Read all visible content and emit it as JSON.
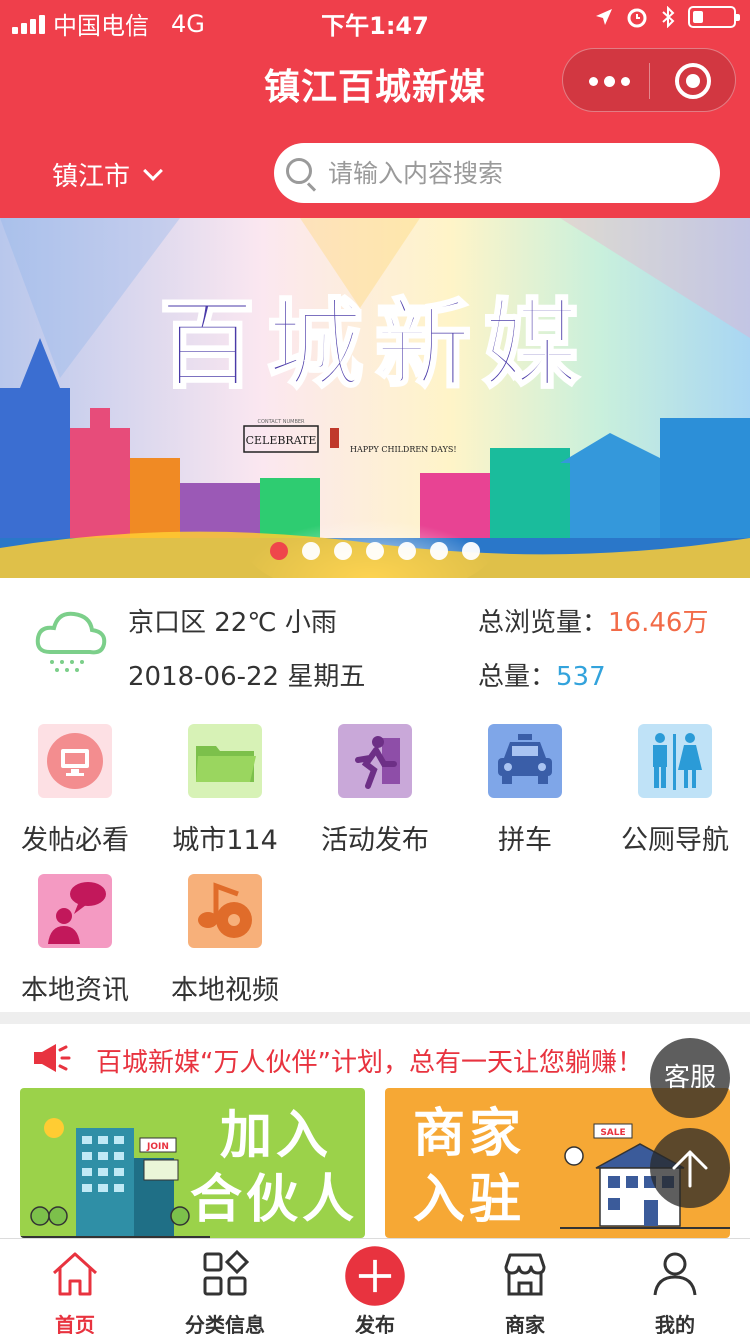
{
  "status_bar": {
    "carrier": "中国电信",
    "network": "4G",
    "time": "下午1:47"
  },
  "nav": {
    "title": "镇江百城新媒"
  },
  "header": {
    "city": "镇江市",
    "search_placeholder": "请输入内容搜索"
  },
  "banner": {
    "title_art": "百城新媒",
    "tag": "CELEBRATE",
    "tag_small": "CONTACT NUMBER",
    "subtitle": "HAPPY CHILDREN DAYS!",
    "slide_count": 7,
    "active_slide": 1
  },
  "info": {
    "weather": "京口区 22℃ 小雨",
    "date": "2018-06-22 星期五",
    "views_label": "总浏览量：",
    "views_value": "16.46万",
    "total_label": "总量：",
    "total_value": "537"
  },
  "categories": [
    {
      "label": "发帖必看",
      "icon": "monitor-icon",
      "color": "#fde0e4"
    },
    {
      "label": "城市114",
      "icon": "folder-icon",
      "color": "#d7f2b6"
    },
    {
      "label": "活动发布",
      "icon": "runner-icon",
      "color": "#c9a8d9"
    },
    {
      "label": "拼车",
      "icon": "car-icon",
      "color": "#7fa6e8"
    },
    {
      "label": "公厕导航",
      "icon": "restroom-icon",
      "color": "#bfe2f7"
    },
    {
      "label": "本地资讯",
      "icon": "chat-user-icon",
      "color": "#f49ac2"
    },
    {
      "label": "本地视频",
      "icon": "music-icon",
      "color": "#f7b07a"
    }
  ],
  "notice": {
    "text": "百城新媒“万人伙伴”计划，总有一天让您躺赚！"
  },
  "promos": {
    "left": {
      "line1": "加入",
      "line2": "合伙人",
      "tag": "JOIN"
    },
    "right": {
      "line1": "商家",
      "line2": "入驻",
      "tag": "SALE"
    }
  },
  "floating": {
    "service": "客服"
  },
  "tabs": [
    {
      "label": "首页",
      "icon": "home-icon",
      "active": true
    },
    {
      "label": "分类信息",
      "icon": "category-icon",
      "active": false
    },
    {
      "label": "发布",
      "icon": "plus-icon",
      "active": false
    },
    {
      "label": "商家",
      "icon": "store-icon",
      "active": false
    },
    {
      "label": "我的",
      "icon": "user-icon",
      "active": false
    }
  ],
  "colors": {
    "brand": "#ef3f4b",
    "accent_orange": "#f26b48",
    "accent_blue": "#33a3dc"
  }
}
